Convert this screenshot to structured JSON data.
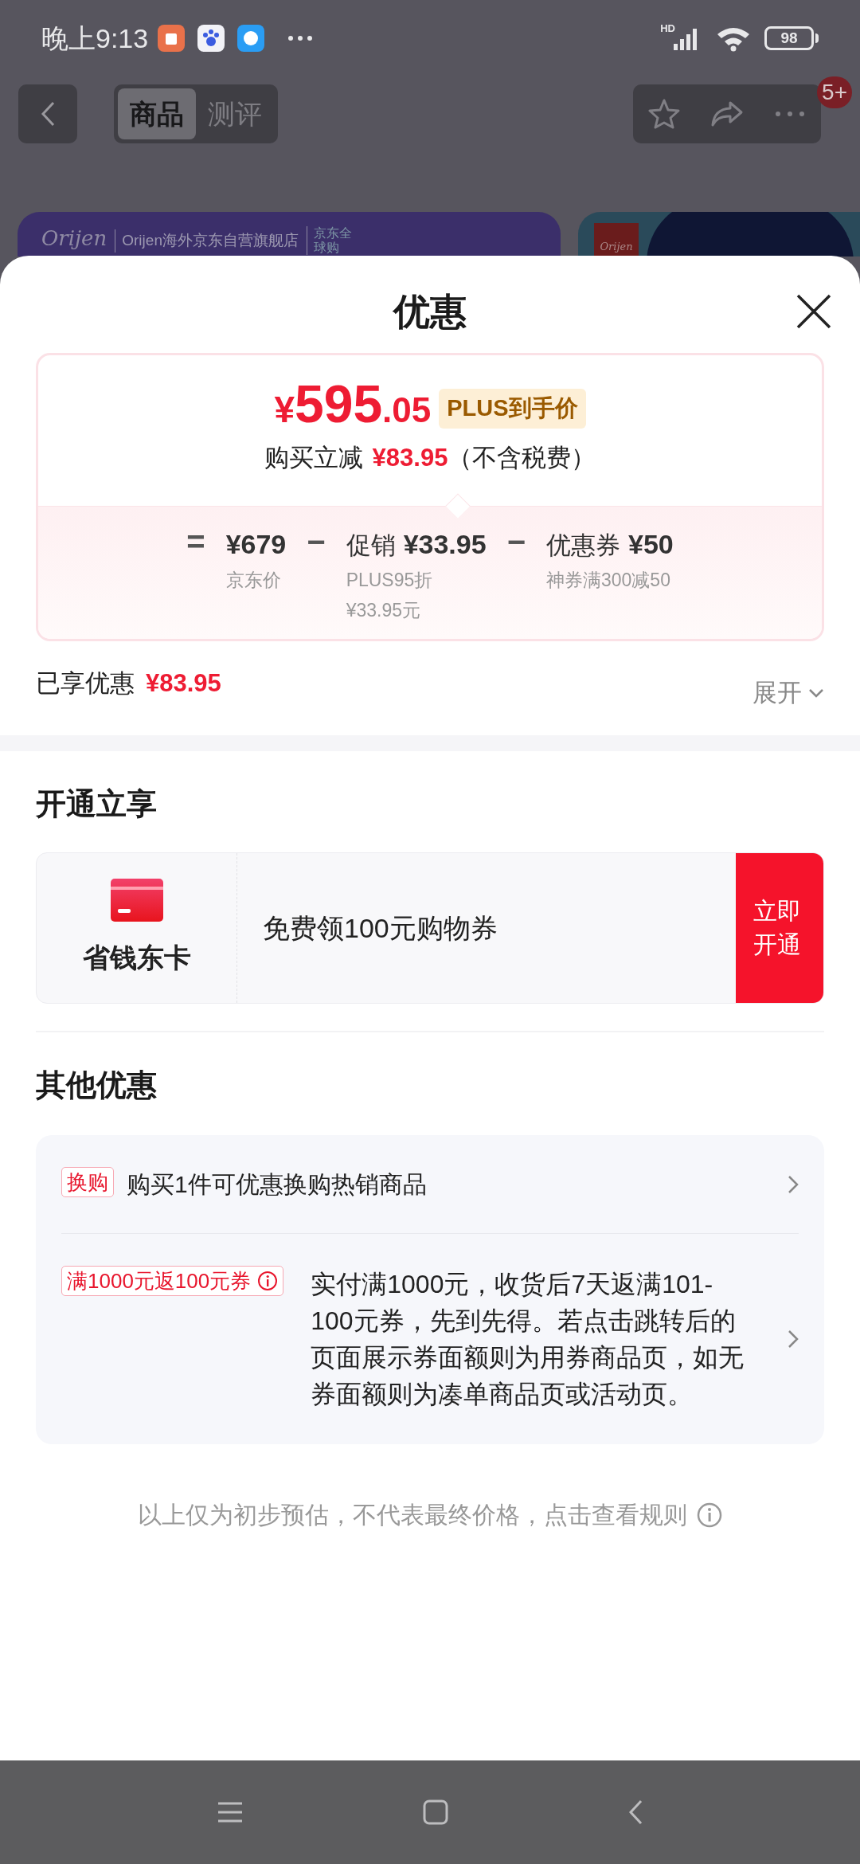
{
  "status_bar": {
    "time": "晚上9:13",
    "network": "HD",
    "battery": "98"
  },
  "top_nav": {
    "tabs": [
      {
        "label": "商品",
        "selected": true
      },
      {
        "label": "测评",
        "selected": false
      }
    ],
    "badge": "5+"
  },
  "banner": {
    "logo": "Orijen",
    "store_name": "Orijen海外京东自营旗舰店",
    "global_label": "京东全球购",
    "second_logo": "Orijen"
  },
  "sheet": {
    "title": "优惠",
    "price": {
      "currency": "¥",
      "integer": "595",
      "decimal": ".05",
      "tag": "PLUS到手价",
      "reduce_label": "购买立减",
      "reduce_amount": "¥83.95",
      "reduce_note": "（不含税费）"
    },
    "breakdown": [
      {
        "operator": "=",
        "amount": "¥679",
        "notes": [
          "京东价"
        ]
      },
      {
        "operator": "−",
        "label": "促销",
        "amount": "¥33.95",
        "notes": [
          "PLUS95折",
          "¥33.95元"
        ]
      },
      {
        "operator": "−",
        "label": "优惠券",
        "amount": "¥50",
        "notes": [
          "神券满300减50"
        ]
      }
    ],
    "enjoyed": {
      "label": "已享优惠",
      "amount": "¥83.95"
    },
    "expand": "展开",
    "membership": {
      "heading": "开通立享",
      "card_name": "省钱东卡",
      "offer": "免费领100元购物券",
      "button": "立即开通"
    },
    "other": {
      "heading": "其他优惠",
      "items": [
        {
          "tag": "换购",
          "info": false,
          "text": "购买1件可优惠换购热销商品"
        },
        {
          "tag": "满1000元返100元券",
          "info": true,
          "text": "实付满1000元，收货后7天返满101-100元券，先到先得。若点击跳转后的页面展示券面额则为用券商品页，如无券面额则为凑单商品页或活动页。"
        }
      ]
    },
    "footer_note": "以上仅为初步预估，不代表最终价格，点击查看规则"
  }
}
